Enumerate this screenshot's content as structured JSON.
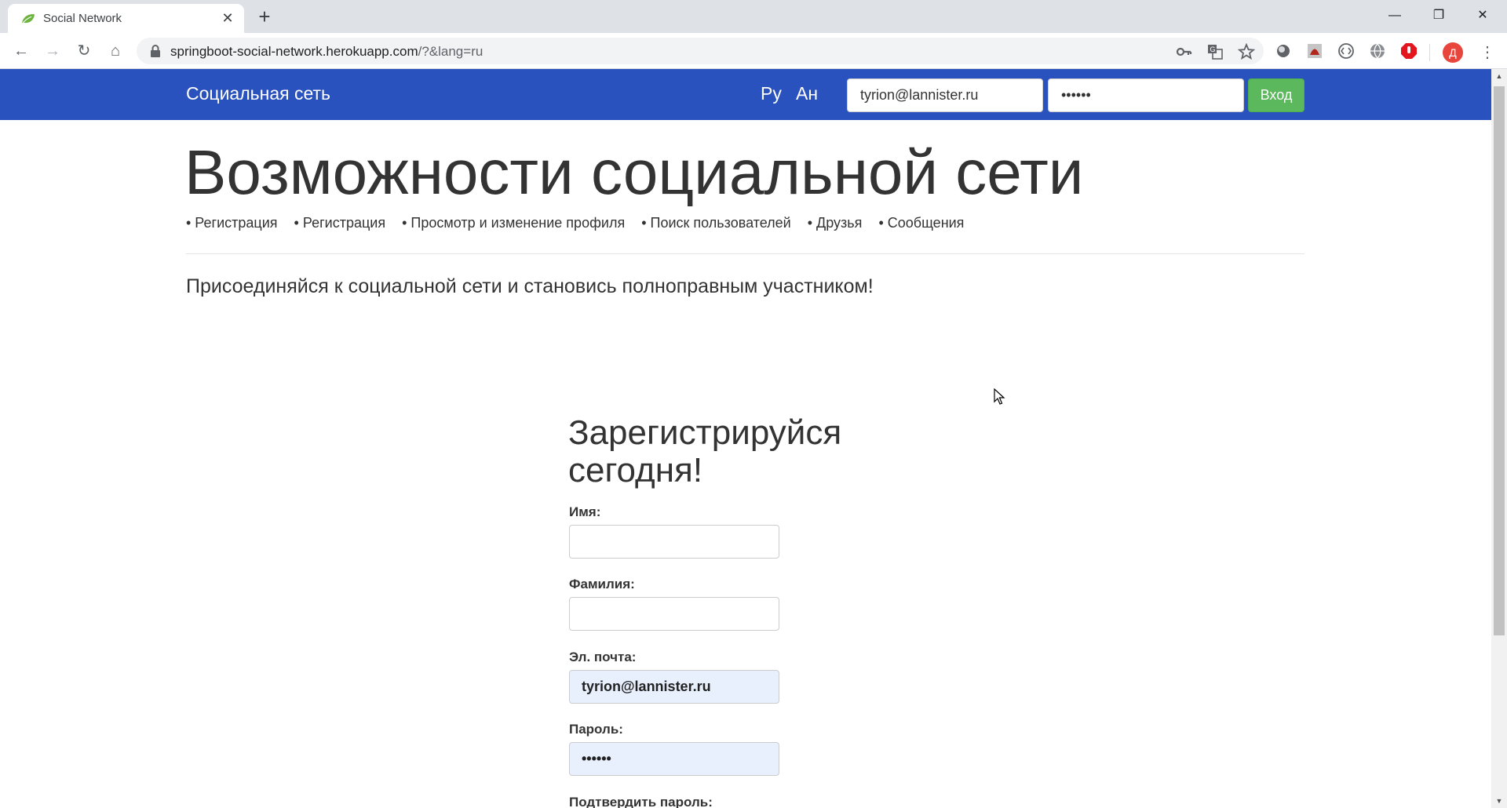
{
  "browser": {
    "tab": {
      "title": "Social Network",
      "close_glyph": "✕",
      "favicon": "leaf-icon"
    },
    "new_tab_glyph": "+",
    "window": {
      "minimize": "—",
      "restore": "❐",
      "close": "✕"
    },
    "nav": {
      "back": "←",
      "forward": "→",
      "reload": "↻",
      "home": "⌂"
    },
    "url_host": "springboot-social-network.herokuapp.com",
    "url_rest": "/?&lang=ru",
    "profile_initial": "Д",
    "menu_glyph": "⋮",
    "icons": [
      "key-icon",
      "translate-icon",
      "star-icon",
      "extension-icon",
      "pdf-icon",
      "code-icon",
      "globe-icon",
      "adblock-icon"
    ]
  },
  "navbar": {
    "brand": "Социальная сеть",
    "lang_ru": "Ру",
    "lang_en": "Ан",
    "email_value": "tyrion@lannister.ru",
    "password_value": "••••••",
    "login_label": "Вход",
    "color": "#2a52be",
    "login_color": "#5cb85c"
  },
  "hero": {
    "title": "Возможности социальной сети",
    "features": [
      "• Регистрация",
      "• Регистрация",
      "• Просмотр и изменение профиля",
      "• Поиск пользователей",
      "• Друзья",
      "• Сообщения"
    ],
    "lead": "Присоединяйся к социальной сети и становись полноправным участником!"
  },
  "register": {
    "title": "Зарегистрируйся сегодня!",
    "first_name_label": "Имя:",
    "first_name_value": "",
    "last_name_label": "Фамилия:",
    "last_name_value": "",
    "email_label": "Эл. почта:",
    "email_value": "tyrion@lannister.ru",
    "password_label": "Пароль:",
    "password_value": "••••••",
    "confirm_label": "Подтвердить пароль:"
  }
}
